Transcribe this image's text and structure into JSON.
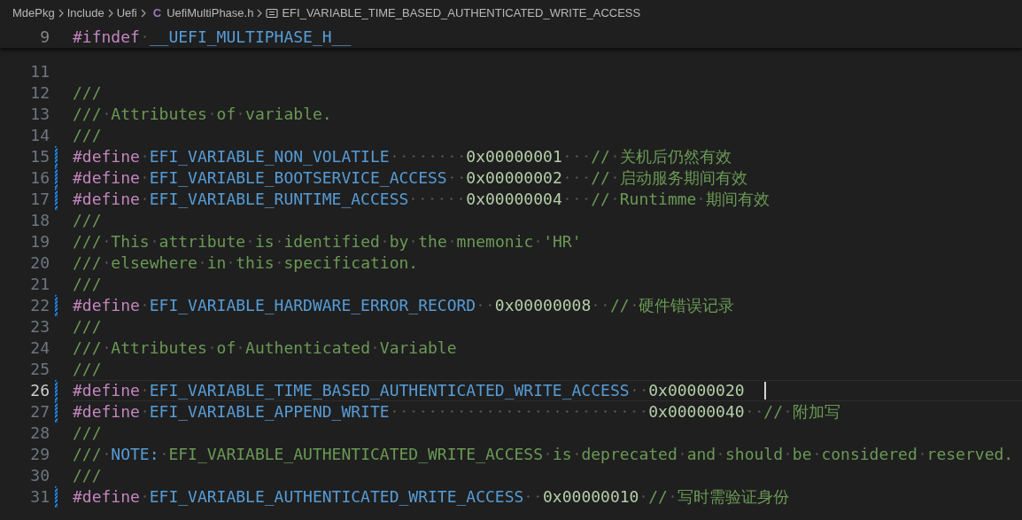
{
  "breadcrumb": [
    {
      "kind": "folder",
      "label": "MdePkg"
    },
    {
      "kind": "folder",
      "label": "Include"
    },
    {
      "kind": "folder",
      "label": "Uefi"
    },
    {
      "kind": "file",
      "icon": "C",
      "label": "UefiMultiPhase.h"
    },
    {
      "kind": "symbol",
      "label": "EFI_VARIABLE_TIME_BASED_AUTHENTICATED_WRITE_ACCESS"
    }
  ],
  "sticky_line": {
    "number": "9",
    "tokens": [
      {
        "kind": "kw",
        "text": "#ifndef"
      },
      {
        "kind": "mac",
        "text": " __UEFI_MULTIPHASE_H__"
      }
    ]
  },
  "lines": [
    {
      "number": "11",
      "modified": false,
      "current": false
    },
    {
      "number": "12",
      "modified": false,
      "current": false,
      "tokens": [
        {
          "kind": "com",
          "text": "///"
        }
      ]
    },
    {
      "number": "13",
      "modified": false,
      "current": false,
      "tokens": [
        {
          "kind": "com",
          "text": "/// Attributes of variable."
        }
      ]
    },
    {
      "number": "14",
      "modified": false,
      "current": false,
      "tokens": [
        {
          "kind": "com",
          "text": "///"
        }
      ]
    },
    {
      "number": "15",
      "modified": true,
      "current": false,
      "tokens": [
        {
          "kind": "kw",
          "text": "#define"
        },
        {
          "kind": "mac",
          "text": " EFI_VARIABLE_NON_VOLATILE        "
        },
        {
          "kind": "num",
          "text": "0x00000001"
        },
        {
          "kind": "com",
          "text": "   // 关机后仍然有效"
        }
      ]
    },
    {
      "number": "16",
      "modified": true,
      "current": false,
      "tokens": [
        {
          "kind": "kw",
          "text": "#define"
        },
        {
          "kind": "mac",
          "text": " EFI_VARIABLE_BOOTSERVICE_ACCESS  "
        },
        {
          "kind": "num",
          "text": "0x00000002"
        },
        {
          "kind": "com",
          "text": "   // 启动服务期间有效"
        }
      ]
    },
    {
      "number": "17",
      "modified": true,
      "current": false,
      "tokens": [
        {
          "kind": "kw",
          "text": "#define"
        },
        {
          "kind": "mac",
          "text": " EFI_VARIABLE_RUNTIME_ACCESS      "
        },
        {
          "kind": "num",
          "text": "0x00000004"
        },
        {
          "kind": "com",
          "text": "   // Runtimme 期间有效"
        }
      ]
    },
    {
      "number": "18",
      "modified": false,
      "current": false,
      "tokens": [
        {
          "kind": "com",
          "text": "///"
        }
      ]
    },
    {
      "number": "19",
      "modified": false,
      "current": false,
      "tokens": [
        {
          "kind": "com",
          "text": "/// This attribute is identified by the mnemonic 'HR'"
        }
      ]
    },
    {
      "number": "20",
      "modified": false,
      "current": false,
      "tokens": [
        {
          "kind": "com",
          "text": "/// elsewhere in this specification."
        }
      ]
    },
    {
      "number": "21",
      "modified": false,
      "current": false,
      "tokens": [
        {
          "kind": "com",
          "text": "///"
        }
      ]
    },
    {
      "number": "22",
      "modified": true,
      "current": false,
      "tokens": [
        {
          "kind": "kw",
          "text": "#define"
        },
        {
          "kind": "mac",
          "text": " EFI_VARIABLE_HARDWARE_ERROR_RECORD  "
        },
        {
          "kind": "num",
          "text": "0x00000008"
        },
        {
          "kind": "com",
          "text": "  // 硬件错误记录"
        }
      ]
    },
    {
      "number": "23",
      "modified": false,
      "current": false,
      "tokens": [
        {
          "kind": "com",
          "text": "///"
        }
      ]
    },
    {
      "number": "24",
      "modified": false,
      "current": false,
      "tokens": [
        {
          "kind": "com",
          "text": "/// Attributes of Authenticated Variable"
        }
      ]
    },
    {
      "number": "25",
      "modified": false,
      "current": false,
      "tokens": [
        {
          "kind": "com",
          "text": "///"
        }
      ]
    },
    {
      "number": "26",
      "modified": true,
      "current": true,
      "tokens": [
        {
          "kind": "kw",
          "text": "#define"
        },
        {
          "kind": "mac",
          "text": " EFI_VARIABLE_TIME_BASED_AUTHENTICATED_WRITE_ACCESS  "
        },
        {
          "kind": "num",
          "text": "0x00000020"
        }
      ]
    },
    {
      "number": "27",
      "modified": true,
      "current": false,
      "tokens": [
        {
          "kind": "kw",
          "text": "#define"
        },
        {
          "kind": "mac",
          "text": " EFI_VARIABLE_APPEND_WRITE                           "
        },
        {
          "kind": "num",
          "text": "0x00000040"
        },
        {
          "kind": "com",
          "text": "  // 附加写"
        }
      ]
    },
    {
      "number": "28",
      "modified": false,
      "current": false,
      "tokens": [
        {
          "kind": "com",
          "text": "///"
        }
      ]
    },
    {
      "number": "29",
      "modified": false,
      "current": false,
      "tokens": [
        {
          "kind": "com",
          "text": "/// "
        },
        {
          "kind": "mac",
          "text": "NOTE:"
        },
        {
          "kind": "com",
          "text": " EFI_VARIABLE_AUTHENTICATED_WRITE_ACCESS is deprecated and should be considered reserved."
        }
      ]
    },
    {
      "number": "30",
      "modified": false,
      "current": false,
      "tokens": [
        {
          "kind": "com",
          "text": "///"
        }
      ]
    },
    {
      "number": "31",
      "modified": true,
      "current": false,
      "tokens": [
        {
          "kind": "kw",
          "text": "#define"
        },
        {
          "kind": "mac",
          "text": " EFI_VARIABLE_AUTHENTICATED_WRITE_ACCESS  "
        },
        {
          "kind": "num",
          "text": "0x00000010"
        },
        {
          "kind": "com",
          "text": " // 写时需验证身份"
        }
      ]
    }
  ]
}
